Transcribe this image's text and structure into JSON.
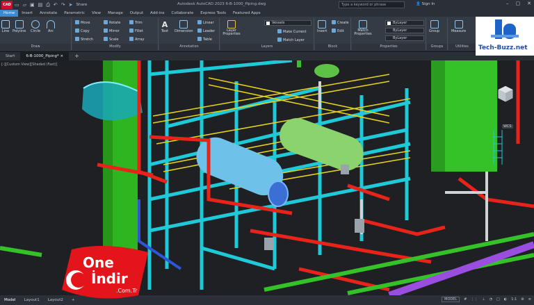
{
  "window": {
    "app_icon": "CAD",
    "title": "Autodesk AutoCAD 2023     6-B-1000_Piping.dwg",
    "share_label": "Share",
    "search_placeholder": "Type a keyword or phrase",
    "signin": "Sign In"
  },
  "menu": [
    "Home",
    "Insert",
    "Annotate",
    "Parametric",
    "View",
    "Manage",
    "Output",
    "Add-ins",
    "Collaborate",
    "Express Tools",
    "Featured Apps"
  ],
  "ribbon": {
    "draw": {
      "label": "Draw",
      "buttons": [
        "Line",
        "Polyline",
        "Circle",
        "Arc"
      ]
    },
    "modify": {
      "label": "Modify",
      "rows": [
        [
          "Move",
          "Rotate",
          "Trim"
        ],
        [
          "Copy",
          "Mirror",
          "Fillet"
        ],
        [
          "Stretch",
          "Scale",
          "Array"
        ]
      ]
    },
    "annotation": {
      "label": "Annotation",
      "buttons": [
        "Text",
        "Dimension"
      ],
      "small": [
        "Linear",
        "Leader",
        "Table"
      ]
    },
    "layers": {
      "label": "Layers",
      "big": "Layer Properties",
      "current_layer": "Vessels",
      "small": [
        "Make Current",
        "Match Layer"
      ]
    },
    "block": {
      "label": "Block",
      "big": "Insert",
      "small": [
        "Create",
        "Edit"
      ]
    },
    "properties": {
      "label": "Properties",
      "big": "Match Properties",
      "values": [
        "ByLayer",
        "ByLayer",
        "ByLayer"
      ]
    },
    "groups": {
      "label": "Groups",
      "big": "Group"
    },
    "utilities": {
      "label": "Utilities",
      "big": "Measure"
    }
  },
  "tabs": [
    "Start",
    "6-B-1000_Piping*"
  ],
  "viewport": {
    "label": "[-][Custom View][Shaded (Fast)]",
    "viewcube_label": "WCS"
  },
  "status": {
    "tabs": [
      "Model",
      "Layout1",
      "Layout2"
    ],
    "mode": "MODEL"
  },
  "watermark_left": {
    "line1": "One",
    "line2": "İndir",
    "line3": ".Com.Tr"
  },
  "watermark_right": {
    "text": "Tech-Buzz.net"
  },
  "colors": {
    "accent": "#3c8bd0",
    "pipe_red": "#e8231a",
    "steel_cyan": "#1fc9d8",
    "vessel_green": "#35c228",
    "grate_yellow": "#e6d21a"
  }
}
